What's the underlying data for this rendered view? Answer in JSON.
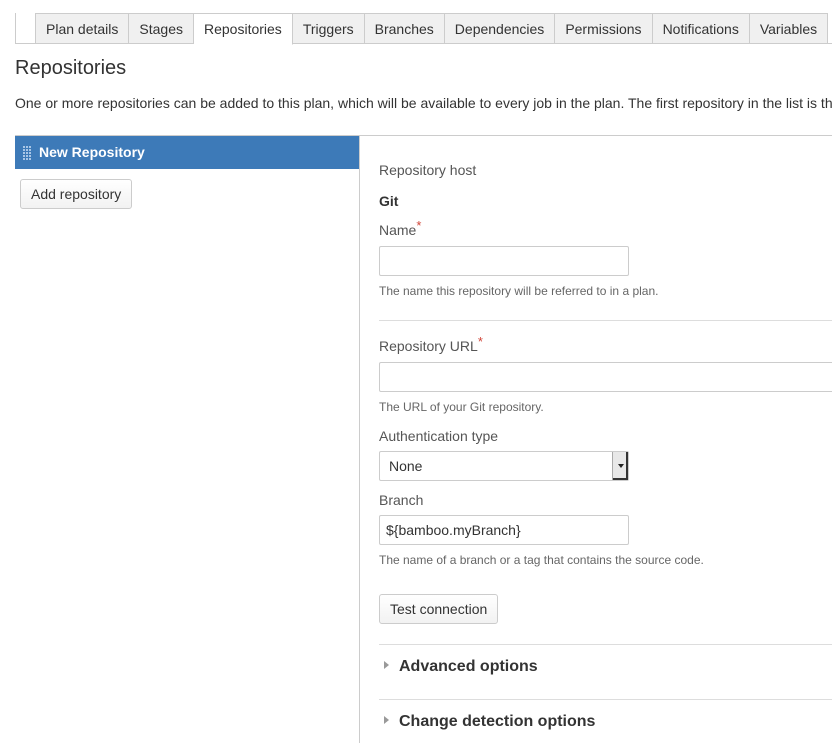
{
  "tabs": [
    {
      "label": "Plan details",
      "active": false
    },
    {
      "label": "Stages",
      "active": false
    },
    {
      "label": "Repositories",
      "active": true
    },
    {
      "label": "Triggers",
      "active": false
    },
    {
      "label": "Branches",
      "active": false
    },
    {
      "label": "Dependencies",
      "active": false
    },
    {
      "label": "Permissions",
      "active": false
    },
    {
      "label": "Notifications",
      "active": false
    },
    {
      "label": "Variables",
      "active": false
    }
  ],
  "page": {
    "title": "Repositories",
    "description": "One or more repositories can be added to this plan, which will be available to every job in the plan. The first repository in the list is th"
  },
  "repo_list": {
    "items": [
      {
        "label": "New Repository",
        "selected": true
      }
    ],
    "add_label": "Add repository"
  },
  "form": {
    "host_label": "Repository host",
    "host_value": "Git",
    "required_mark": "*",
    "name": {
      "label": "Name",
      "value": "",
      "help": "The name this repository will be referred to in a plan."
    },
    "url": {
      "label": "Repository URL",
      "value": "",
      "help": "The URL of your Git repository."
    },
    "auth": {
      "label": "Authentication type",
      "value": "None"
    },
    "branch": {
      "label": "Branch",
      "value": "${bamboo.myBranch}",
      "help": "The name of a branch or a tag that contains the source code."
    },
    "test_label": "Test connection",
    "sections": [
      {
        "label": "Advanced options",
        "expanded": false
      },
      {
        "label": "Change detection options",
        "expanded": false
      }
    ]
  },
  "colors": {
    "accent": "#3d7ab8",
    "required": "#d04437",
    "tab_bg": "#f0f0f0",
    "border": "#cccccc"
  }
}
